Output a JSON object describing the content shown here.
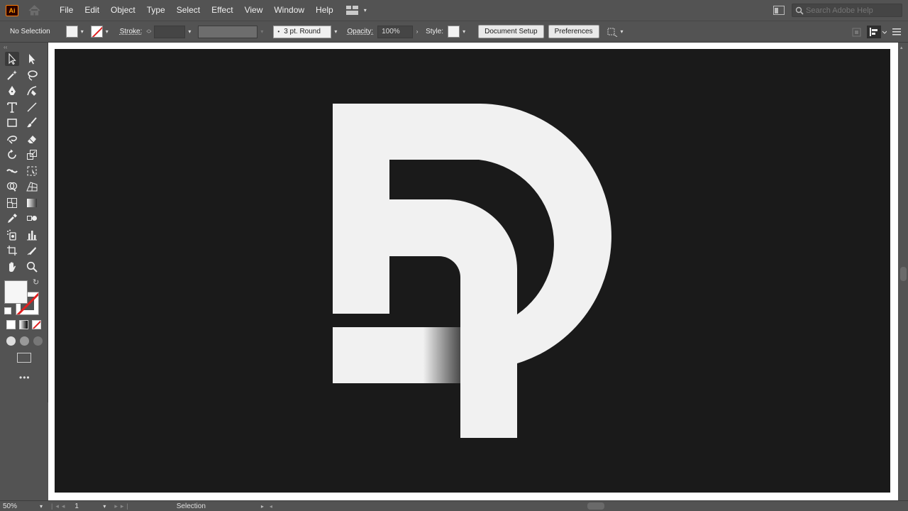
{
  "app": {
    "logo_text": "Ai"
  },
  "menu": [
    "File",
    "Edit",
    "Object",
    "Type",
    "Select",
    "Effect",
    "View",
    "Window",
    "Help"
  ],
  "search": {
    "placeholder": "Search Adobe Help"
  },
  "control": {
    "selection_status": "No Selection",
    "stroke_label": "Stroke:",
    "stroke_value": "",
    "brush_value": "3 pt. Round",
    "opacity_label": "Opacity:",
    "opacity_value": "100%",
    "style_label": "Style:",
    "document_setup": "Document Setup",
    "preferences": "Preferences"
  },
  "colors": {
    "artboard": "#1a1a1a",
    "logo_fill": "#f1f1f1",
    "ui_bg": "#535353",
    "stroke_none_red": "#e02020"
  },
  "tools": [
    [
      "selection-tool",
      "direct-selection-tool"
    ],
    [
      "magic-wand-tool",
      "lasso-tool"
    ],
    [
      "pen-tool",
      "curvature-tool"
    ],
    [
      "type-tool",
      "line-segment-tool"
    ],
    [
      "rectangle-tool",
      "paintbrush-tool"
    ],
    [
      "shaper-tool",
      "eraser-tool"
    ],
    [
      "rotate-tool",
      "scale-tool"
    ],
    [
      "width-tool",
      "free-transform-tool"
    ],
    [
      "shape-builder-tool",
      "perspective-grid-tool"
    ],
    [
      "mesh-tool",
      "gradient-tool"
    ],
    [
      "eyedropper-tool",
      "blend-tool"
    ],
    [
      "symbol-sprayer-tool",
      "column-graph-tool"
    ],
    [
      "artboard-tool",
      "slice-tool"
    ],
    [
      "hand-tool",
      "zoom-tool"
    ]
  ],
  "status": {
    "zoom": "50%",
    "artboard_number": "1",
    "current_tool": "Selection"
  }
}
